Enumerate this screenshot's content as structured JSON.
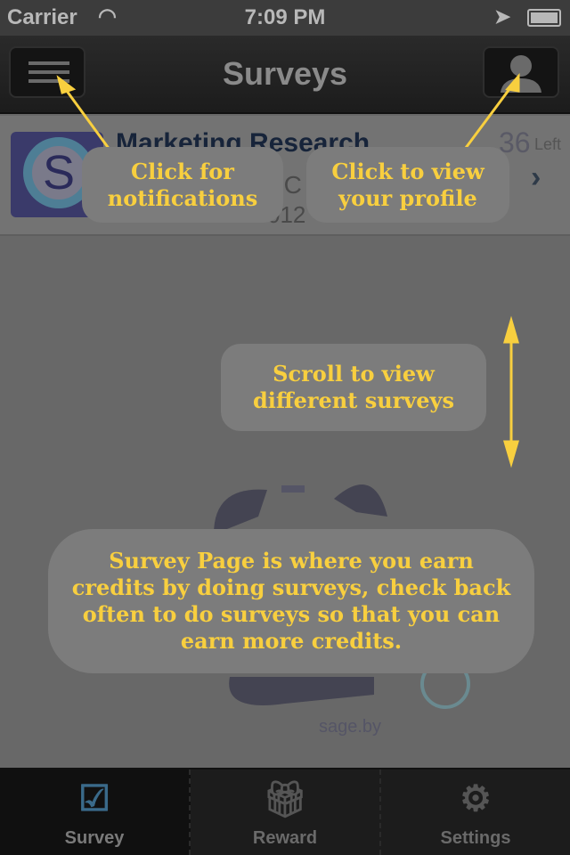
{
  "status": {
    "carrier": "Carrier",
    "time": "7:09 PM"
  },
  "nav": {
    "title": "Surveys"
  },
  "survey": {
    "title": "Marketing Research",
    "subtitle": "SC",
    "date": "012",
    "count": "36",
    "count_label": "Left",
    "logo_letter": "S"
  },
  "illustration": {
    "watermark": "sage.by"
  },
  "callouts": {
    "notifications": "Click for notifications",
    "profile": "Click to view your profile",
    "scroll": "Scroll to view different surveys",
    "info": "Survey Page is where you earn credits by doing surveys, check back often to do surveys so that you can earn more credits."
  },
  "tabs": [
    {
      "label": "Survey",
      "icon": "checkbox-icon"
    },
    {
      "label": "Reward",
      "icon": "gift-icon"
    },
    {
      "label": "Settings",
      "icon": "gear-icon"
    }
  ],
  "colors": {
    "callout_text": "#f8cf3f",
    "callout_bg": "#7c7c7c"
  }
}
